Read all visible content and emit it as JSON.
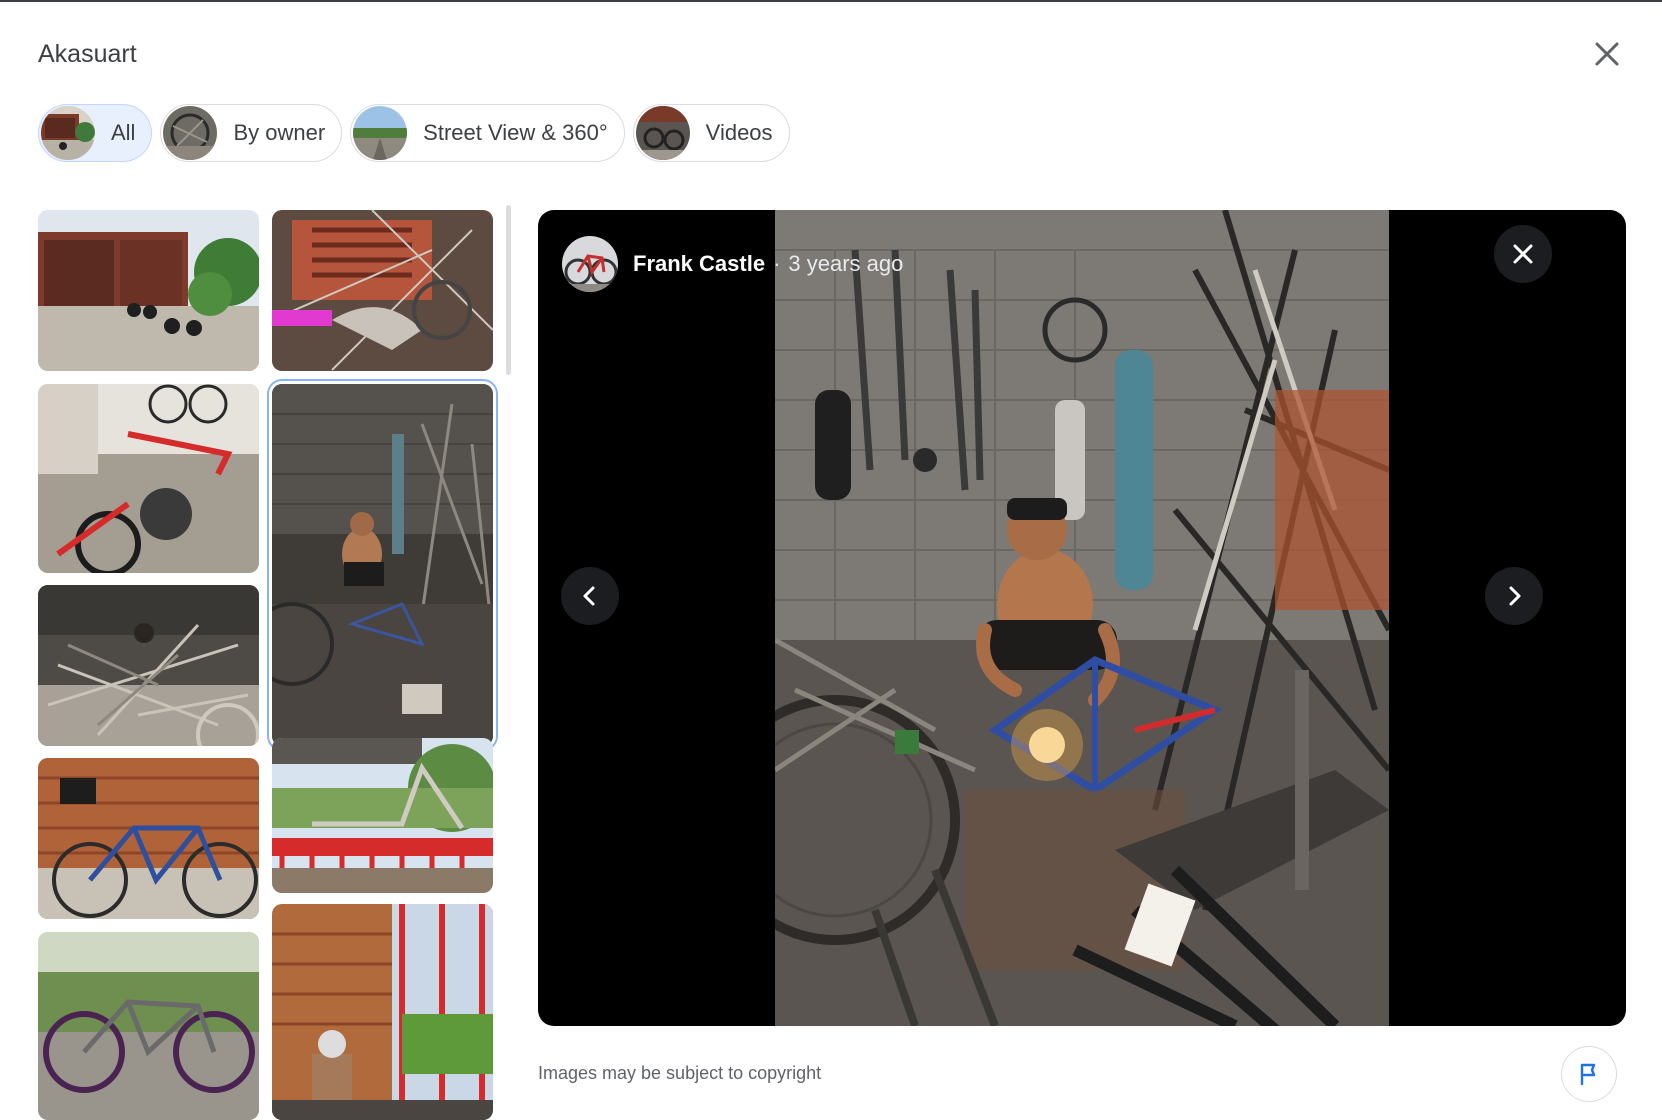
{
  "header": {
    "title": "Akasuart"
  },
  "filters": [
    {
      "label": "All",
      "active": true
    },
    {
      "label": "By owner",
      "active": false
    },
    {
      "label": "Street View & 360°",
      "active": false
    },
    {
      "label": "Videos",
      "active": false
    }
  ],
  "viewer": {
    "author_name": "Frank Castle",
    "separator": "·",
    "time_ago": "3 years ago"
  },
  "footer": {
    "copyright_text": "Images may be subject to copyright"
  },
  "icons": {
    "close_dialog": "close-icon",
    "close_viewer": "close-icon",
    "previous": "chevron-left-icon",
    "next": "chevron-right-icon",
    "report": "flag-icon"
  },
  "colors": {
    "active_chip_bg": "#e8f0fe",
    "selection_outline": "#8ab4f8",
    "report_icon": "#1a73e8"
  }
}
